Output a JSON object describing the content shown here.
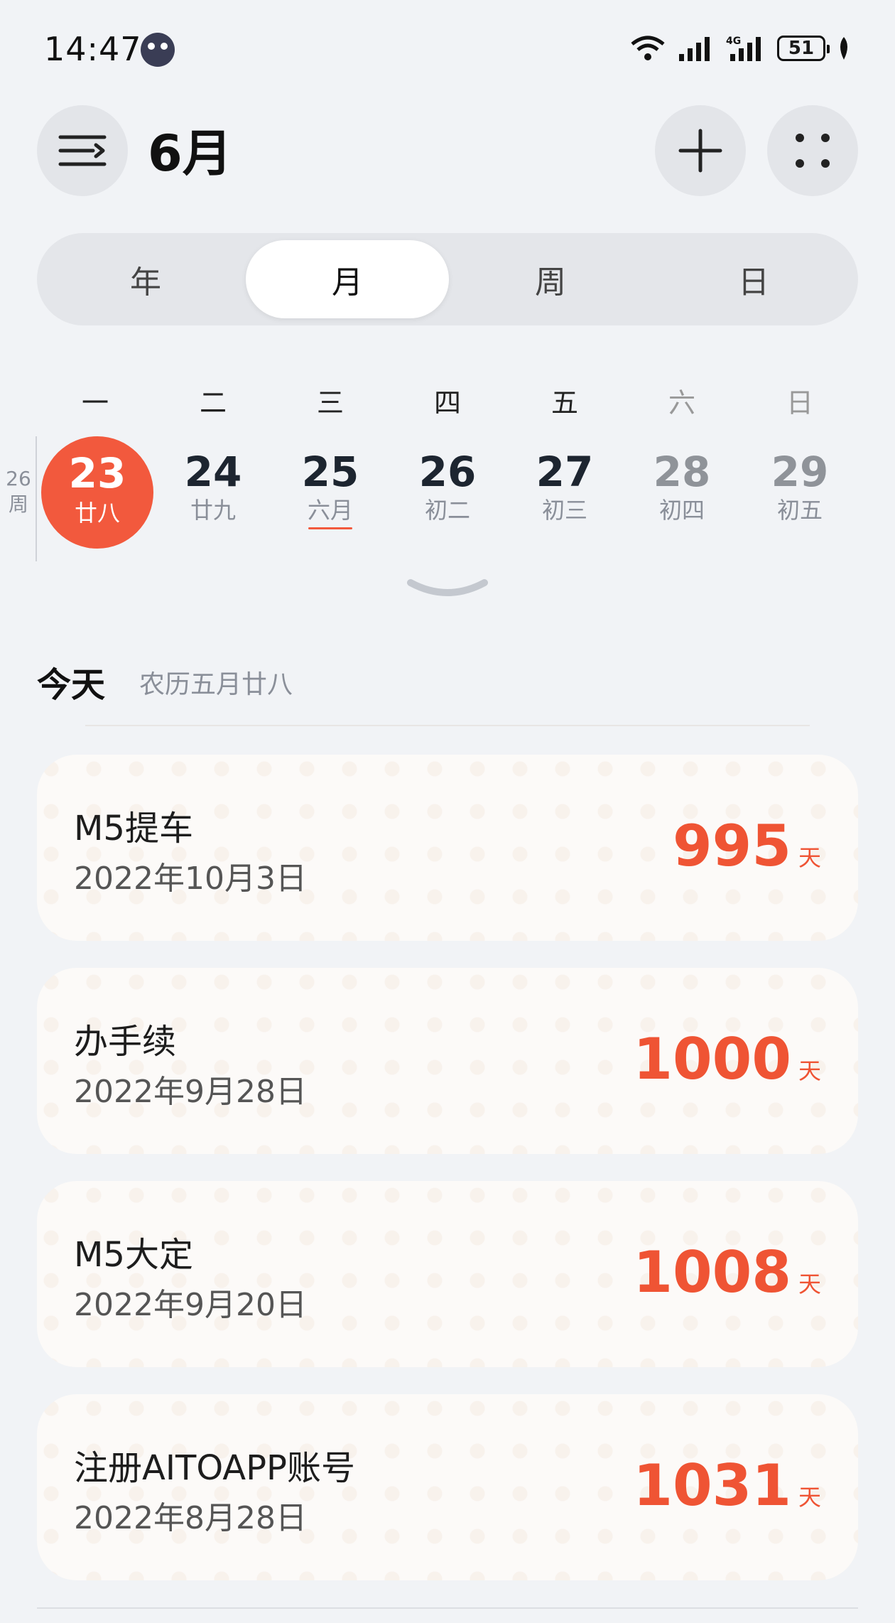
{
  "status_bar": {
    "time": "14:47",
    "battery": "51"
  },
  "header": {
    "month_title": "6月"
  },
  "view_tabs": [
    "年",
    "月",
    "周",
    "日"
  ],
  "weekdays": [
    "一",
    "二",
    "三",
    "四",
    "五",
    "六",
    "日"
  ],
  "week": {
    "number": "26",
    "unit": "周",
    "days": [
      {
        "num": "23",
        "lunar": "廿八"
      },
      {
        "num": "24",
        "lunar": "廿九"
      },
      {
        "num": "25",
        "lunar": "六月"
      },
      {
        "num": "26",
        "lunar": "初二"
      },
      {
        "num": "27",
        "lunar": "初三"
      },
      {
        "num": "28",
        "lunar": "初四"
      },
      {
        "num": "29",
        "lunar": "初五"
      }
    ]
  },
  "today": {
    "label": "今天",
    "lunar": "农历五月廿八"
  },
  "events": [
    {
      "title": "M5提车",
      "date": "2022年10月3日",
      "days": "995",
      "unit": "天"
    },
    {
      "title": "办手续",
      "date": "2022年9月28日",
      "days": "1000",
      "unit": "天"
    },
    {
      "title": "M5大定",
      "date": "2022年9月20日",
      "days": "1008",
      "unit": "天"
    },
    {
      "title": "注册AITOAPP账号",
      "date": "2022年8月28日",
      "days": "1031",
      "unit": "天"
    }
  ],
  "colors": {
    "accent": "#f2593d",
    "background": "#f1f3f6"
  }
}
